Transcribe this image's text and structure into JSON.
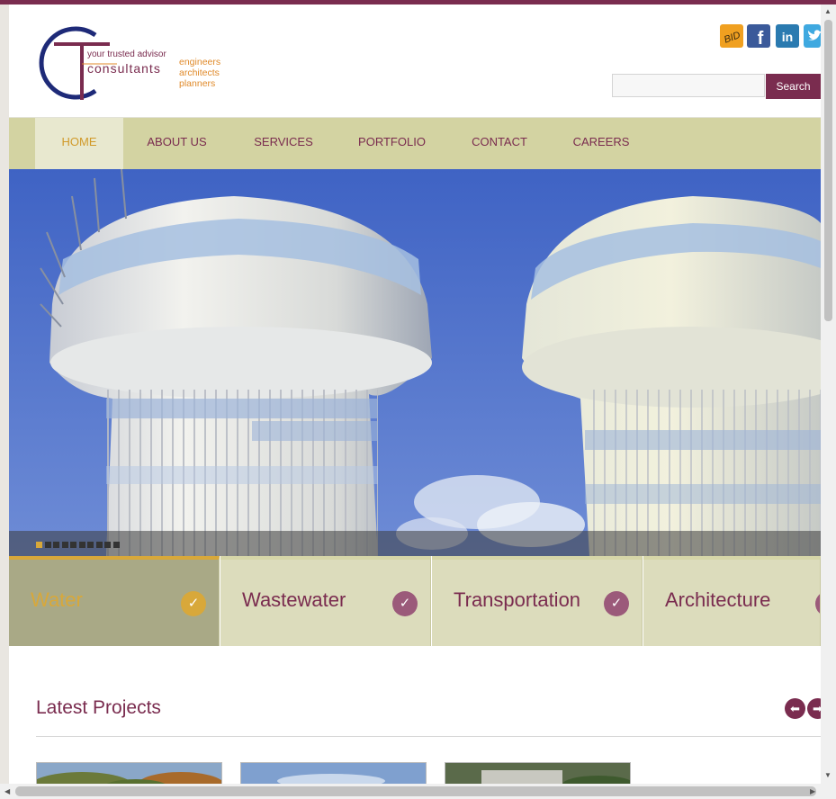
{
  "header": {
    "logo": {
      "tagline": "your trusted advisor",
      "brand": "consultants",
      "professions": [
        "engineers",
        "architects",
        "planners"
      ]
    },
    "social": [
      {
        "icon": "bid-icon",
        "label": "BID"
      },
      {
        "icon": "facebook-icon",
        "label": "f"
      },
      {
        "icon": "linkedin-icon",
        "label": "in"
      },
      {
        "icon": "twitter-icon",
        "label": ""
      }
    ],
    "search": {
      "placeholder": "",
      "button_label": "Search"
    }
  },
  "nav": {
    "items": [
      {
        "label": "HOME",
        "active": true
      },
      {
        "label": "ABOUT US",
        "active": false
      },
      {
        "label": "SERVICES",
        "active": false
      },
      {
        "label": "PORTFOLIO",
        "active": false
      },
      {
        "label": "CONTACT",
        "active": false
      },
      {
        "label": "CAREERS",
        "active": false
      }
    ]
  },
  "slider": {
    "slide_count": 10,
    "active_index": 0
  },
  "categories": [
    {
      "label": "Water",
      "active": true
    },
    {
      "label": "Wastewater",
      "active": false
    },
    {
      "label": "Transportation",
      "active": false
    },
    {
      "label": "Architecture",
      "active": false
    }
  ],
  "latest": {
    "title": "Latest Projects",
    "prev_icon": "arrow-left-icon",
    "next_icon": "arrow-right-icon"
  },
  "colors": {
    "brand": "#7a2c4f",
    "accent": "#d8a83a",
    "nav_bg": "#d3d3a2",
    "logo_blue": "#1e2a78"
  }
}
